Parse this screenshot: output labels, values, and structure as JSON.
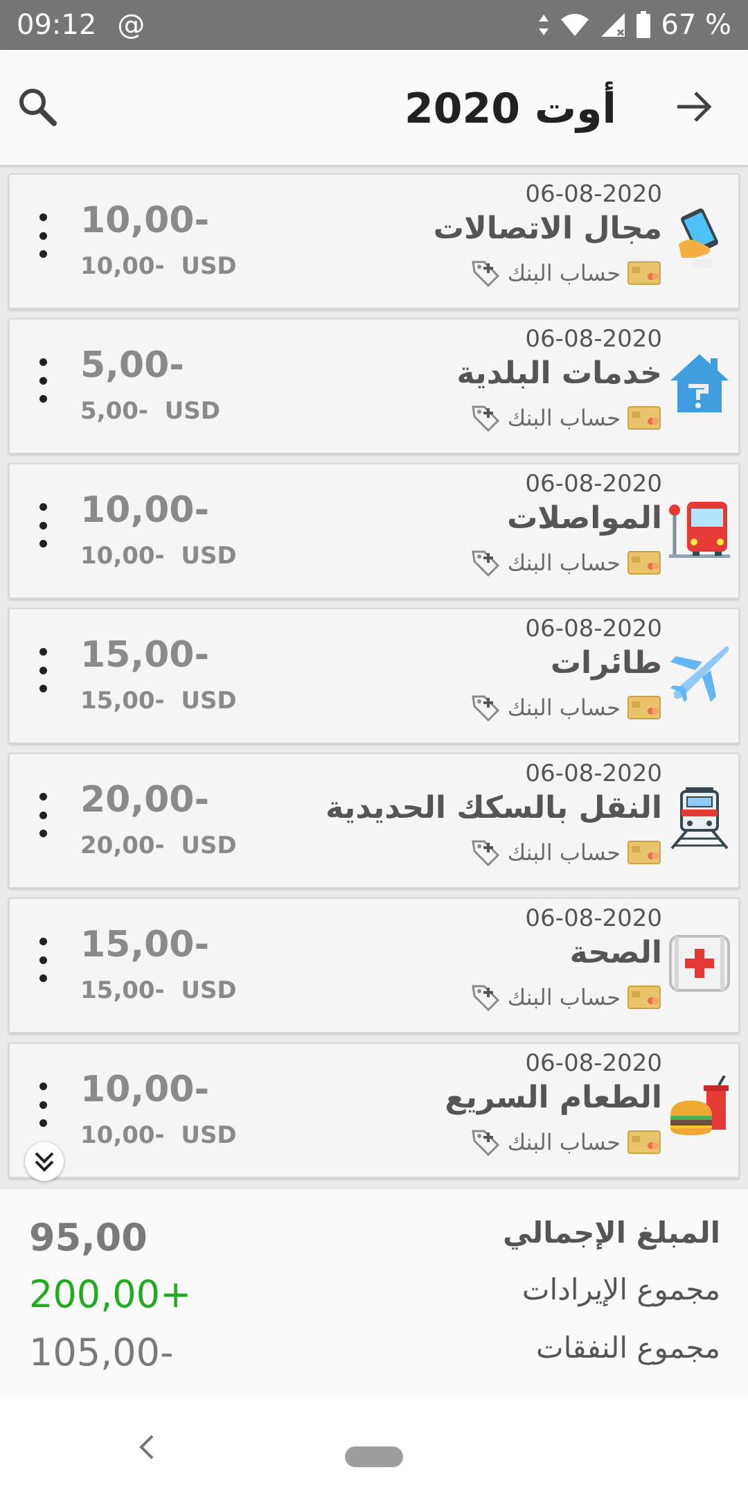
{
  "status_bar": {
    "time": "09:12",
    "at_symbol": "@",
    "battery": "67 %"
  },
  "header": {
    "title": "أوت 2020",
    "search_icon": "search-icon",
    "next_icon": "arrow-right-icon"
  },
  "transactions": [
    {
      "date": "06-08-2020",
      "category": "مجال الاتصالات",
      "account": "حساب البنك",
      "amount": "10,00-",
      "amount_usd": "10,00-  USD",
      "icon": "phone-icon"
    },
    {
      "date": "06-08-2020",
      "category": "خدمات البلدية",
      "account": "حساب البنك",
      "amount": "5,00-",
      "amount_usd": "5,00-  USD",
      "icon": "house-utilities-icon"
    },
    {
      "date": "06-08-2020",
      "category": "المواصلات",
      "account": "حساب البنك",
      "amount": "10,00-",
      "amount_usd": "10,00-  USD",
      "icon": "bus-icon"
    },
    {
      "date": "06-08-2020",
      "category": "طائرات",
      "account": "حساب البنك",
      "amount": "15,00-",
      "amount_usd": "15,00-  USD",
      "icon": "airplane-icon"
    },
    {
      "date": "06-08-2020",
      "category": "النقل بالسكك الحديدية",
      "account": "حساب البنك",
      "amount": "20,00-",
      "amount_usd": "20,00-  USD",
      "icon": "train-icon"
    },
    {
      "date": "06-08-2020",
      "category": "الصحة",
      "account": "حساب البنك",
      "amount": "15,00-",
      "amount_usd": "15,00-  USD",
      "icon": "first-aid-icon"
    },
    {
      "date": "06-08-2020",
      "category": "الطعام السريع",
      "account": "حساب البنك",
      "amount": "10,00-",
      "amount_usd": "10,00-  USD",
      "icon": "fast-food-icon"
    }
  ],
  "summary": {
    "total_label": "المبلغ الإجمالي",
    "total_value": "95,00",
    "income_label": "مجموع الإيرادات",
    "income_value": "200,00+",
    "expense_label": "مجموع النفقات",
    "expense_value": "105,00-",
    "income_color": "#1fad1f"
  }
}
